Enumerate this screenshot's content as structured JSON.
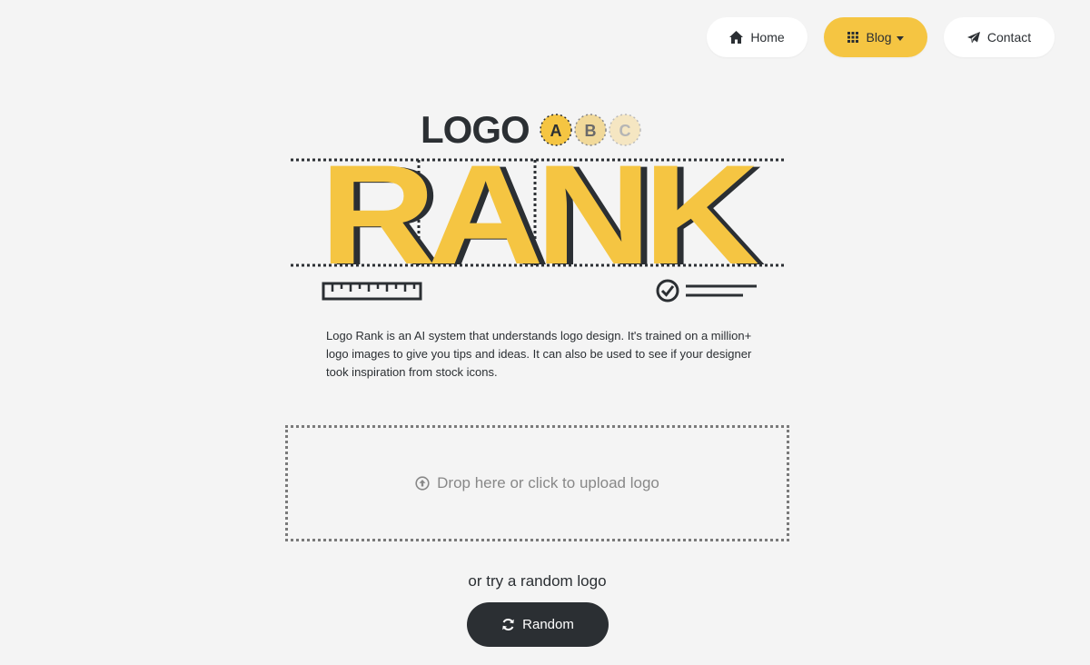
{
  "nav": {
    "home_label": "Home",
    "blog_label": "Blog",
    "contact_label": "Contact"
  },
  "hero": {
    "logo_word": "LOGO",
    "letters": [
      "A",
      "B",
      "C"
    ],
    "rank_word": "RANK"
  },
  "description": "Logo Rank is an AI system that understands logo design. It's trained on a million+ logo images to give you tips and ideas. It can also be used to see if your designer took inspiration from stock icons.",
  "upload": {
    "label": "Drop here or click to upload logo",
    "icon": "upload-circle-icon"
  },
  "random": {
    "prompt": "or try a random logo",
    "button_label": "Random",
    "icon": "refresh-icon"
  },
  "colors": {
    "accent": "#f5c542",
    "dark": "#2b2f33",
    "background": "#f4f4f4"
  }
}
